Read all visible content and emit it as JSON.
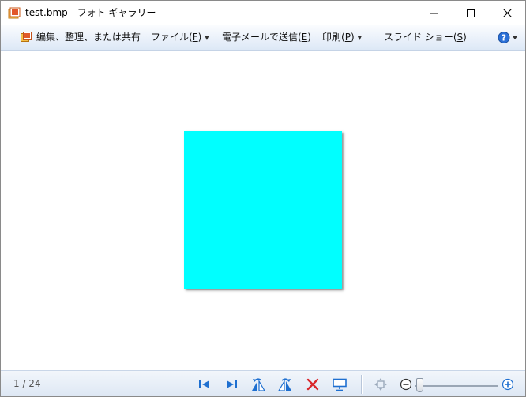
{
  "window": {
    "title": "test.bmp - フォト ギャラリー"
  },
  "menubar": {
    "organize_label": "編集、整理、または共有",
    "file_label": "ファイル(",
    "file_key": "F",
    "file_close": ")",
    "mail_label": "電子メールで送信(",
    "mail_key": "E",
    "mail_close": ")",
    "print_label": "印刷(",
    "print_key": "P",
    "print_close": ")",
    "slideshow_label": "スライド ショー(",
    "slideshow_key": "S",
    "slideshow_close": ")"
  },
  "viewer": {
    "photo_color": "#00ffff"
  },
  "statusbar": {
    "counter": "1 / 24"
  },
  "colors": {
    "accent_blue": "#1e6fd0",
    "delete_red": "#d9262b"
  }
}
